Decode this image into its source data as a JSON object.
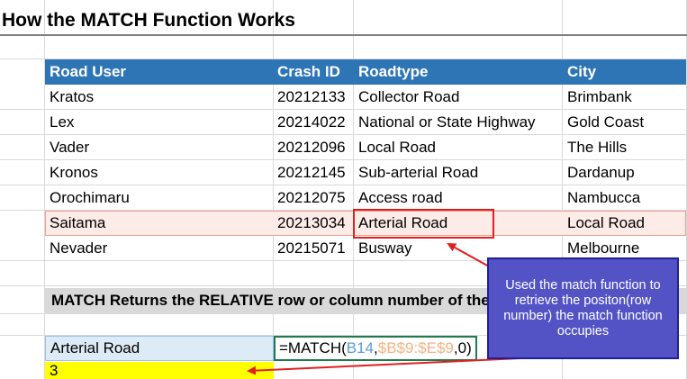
{
  "title": "How the MATCH Function Works",
  "table": {
    "headers": [
      "Road User",
      "Crash ID",
      "Roadtype",
      "City"
    ],
    "rows": [
      [
        "Kratos",
        "20212133",
        "Collector Road",
        "Brimbank"
      ],
      [
        "Lex",
        "20214022",
        "National or State Highway",
        "Gold Coast"
      ],
      [
        "Vader",
        "20212096",
        "Local Road",
        "The Hills"
      ],
      [
        "Kronos",
        "20212145",
        "Sub-arterial Road",
        "Dardanup"
      ],
      [
        "Orochimaru",
        "20212075",
        "Access road",
        "Nambucca"
      ],
      [
        "Saitama",
        "20213034",
        "Arterial Road",
        "Local Road"
      ],
      [
        "Nevader",
        "20215071",
        "Busway",
        "Melbourne"
      ]
    ],
    "highlighted_row": "Saitama"
  },
  "note": "MATCH Returns the RELATIVE row or column number of the",
  "lookup_value": "Arterial Road",
  "formula": {
    "prefix": "=MATCH(",
    "ref1": "B14",
    "sep1": ",",
    "ref2": "$B$9:$E$9",
    "suffix": ",0)"
  },
  "result": "3",
  "callout": {
    "text": "Used the match function to retrieve the positon(row number) the match function occupies"
  },
  "colors": {
    "header_bg": "#2e75b6",
    "highlight_row_bg": "#fcebe7",
    "callout_bg": "#5353c6",
    "result_bg": "#ffff00",
    "arrow": "#e02020"
  }
}
